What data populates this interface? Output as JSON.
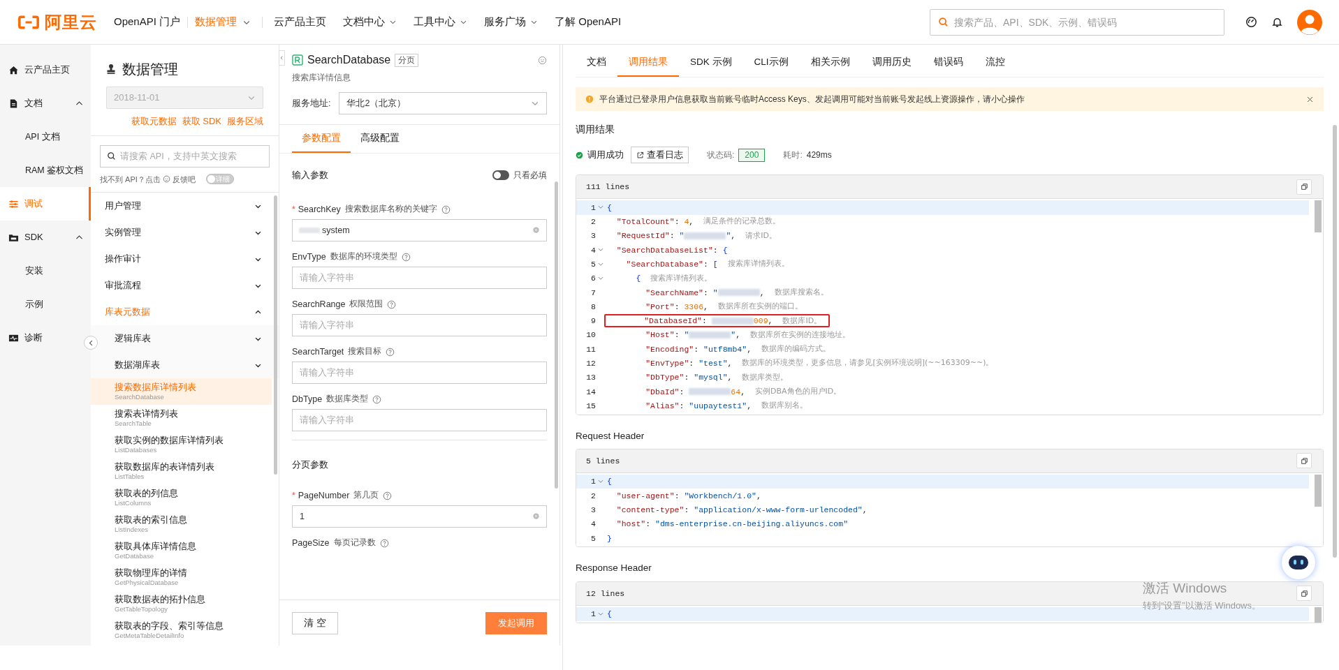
{
  "header": {
    "logo": "阿里云",
    "portal": "OpenAPI 门户",
    "product": {
      "label": "数据管理"
    },
    "nav": [
      {
        "label": "云产品主页",
        "dropdown": false
      },
      {
        "label": "文档中心",
        "dropdown": true
      },
      {
        "label": "工具中心",
        "dropdown": true
      },
      {
        "label": "服务广场",
        "dropdown": true
      },
      {
        "label": "了解 OpenAPI",
        "dropdown": false
      }
    ],
    "search": {
      "placeholder": "搜索产品、API、SDK、示例、错误码"
    }
  },
  "sidebar": {
    "items": [
      {
        "label": "云产品主页",
        "selected": false
      },
      {
        "label": "文档",
        "selected": false,
        "expanded": true,
        "children": [
          {
            "label": "API 文档",
            "selected": false
          },
          {
            "label": "RAM 鉴权文档",
            "selected": false
          }
        ]
      },
      {
        "label": "调试",
        "selected": true
      },
      {
        "label": "SDK",
        "selected": false,
        "expanded": true,
        "children": [
          {
            "label": "安装",
            "selected": false
          },
          {
            "label": "示例",
            "selected": false
          }
        ]
      },
      {
        "label": "诊断",
        "selected": false
      }
    ]
  },
  "api_panel": {
    "title": "数据管理",
    "version": {
      "value": "2018-11-01",
      "disabled": true
    },
    "links": [
      "获取元数据",
      "获取 SDK",
      "服务区域"
    ],
    "search": {
      "placeholder": "请搜索 API，支持中英文搜索"
    },
    "feedback": {
      "prefix": "找不到 API？点击",
      "link": "反馈吧"
    },
    "detail_toggle": {
      "label": "详细",
      "on": false
    },
    "tree": [
      {
        "kind": "group",
        "label": "用户管理",
        "expanded": false
      },
      {
        "kind": "group",
        "label": "实例管理",
        "expanded": false
      },
      {
        "kind": "group",
        "label": "操作审计",
        "expanded": false
      },
      {
        "kind": "group",
        "label": "审批流程",
        "expanded": false
      },
      {
        "kind": "group",
        "label": "库表元数据",
        "expanded": true,
        "children": [
          {
            "kind": "group",
            "label": "逻辑库表",
            "expanded": false
          },
          {
            "kind": "group",
            "label": "数据湖库表",
            "expanded": false
          },
          {
            "kind": "api",
            "label": "搜索数据库详情列表",
            "code": "SearchDatabase",
            "selected": true
          },
          {
            "kind": "api",
            "label": "搜索表详情列表",
            "code": "SearchTable",
            "selected": false
          },
          {
            "kind": "api",
            "label": "获取实例的数据库详情列表",
            "code": "ListDatabases",
            "selected": false
          },
          {
            "kind": "api",
            "label": "获取数据库的表详情列表",
            "code": "ListTables",
            "selected": false
          },
          {
            "kind": "api",
            "label": "获取表的列信息",
            "code": "ListColumns",
            "selected": false
          },
          {
            "kind": "api",
            "label": "获取表的索引信息",
            "code": "ListIndexes",
            "selected": false
          },
          {
            "kind": "api",
            "label": "获取具体库详情信息",
            "code": "GetDatabase",
            "selected": false
          },
          {
            "kind": "api",
            "label": "获取物理库的详情",
            "code": "GetPhysicalDatabase",
            "selected": false
          },
          {
            "kind": "api",
            "label": "获取数据表的拓扑信息",
            "code": "GetTableTopology",
            "selected": false
          },
          {
            "kind": "api",
            "label": "获取表的字段、索引等信息",
            "code": "GetMetaTableDetailInfo",
            "selected": false
          }
        ]
      }
    ]
  },
  "api_form": {
    "name": "SearchDatabase",
    "tag": "分页",
    "description": "搜索库详情信息",
    "endpoint": {
      "label": "服务地址:",
      "value": "华北2（北京）"
    },
    "tabs": [
      {
        "label": "参数配置",
        "selected": true
      },
      {
        "label": "高级配置",
        "selected": false
      }
    ],
    "required_only": {
      "label": "只看必填",
      "on": false
    },
    "sections": [
      {
        "title": "输入参数",
        "fields": [
          {
            "name": "SearchKey",
            "description": "搜索数据库名称的关键字",
            "required_mark": "*",
            "value": "system",
            "masked": true
          },
          {
            "name": "EnvType",
            "description": "数据库的环境类型",
            "placeholder": "请输入字符串"
          },
          {
            "name": "SearchRange",
            "description": "权限范围",
            "placeholder": "请输入字符串"
          },
          {
            "name": "SearchTarget",
            "description": "搜索目标",
            "placeholder": "请输入字符串"
          },
          {
            "name": "DbType",
            "description": "数据库类型",
            "placeholder": "请输入字符串"
          }
        ]
      },
      {
        "title": "分页参数",
        "fields": [
          {
            "name": "PageNumber",
            "description": "第几页",
            "required_mark": "*",
            "value": "1"
          },
          {
            "name": "PageSize",
            "description": "每页记录数"
          }
        ]
      }
    ],
    "buttons": {
      "clear": "清 空",
      "submit": "发起调用"
    }
  },
  "result_panel": {
    "tabs": [
      {
        "label": "文档",
        "selected": false
      },
      {
        "label": "调用结果",
        "selected": true
      },
      {
        "label": "SDK 示例",
        "selected": false
      },
      {
        "label": "CLI示例",
        "selected": false
      },
      {
        "label": "相关示例",
        "selected": false
      },
      {
        "label": "调用历史",
        "selected": false
      },
      {
        "label": "错误码",
        "selected": false
      },
      {
        "label": "流控",
        "selected": false
      }
    ],
    "notice": "平台通过已登录用户信息获取当前账号临时Access Keys、发起调用可能对当前账号发起线上资源操作，请小心操作",
    "title": "调用结果",
    "status": {
      "label": "调用成功",
      "log_button": "查看日志",
      "code_label": "状态码:",
      "code": "200",
      "time_label": "耗时:",
      "time": "429ms"
    },
    "blocks": [
      {
        "line_count": "111 lines",
        "lines": [
          {
            "no": "1",
            "fold": true,
            "current": true,
            "boxed": false,
            "tokens": [
              {
                "kind": "brace",
                "text": "{"
              }
            ]
          },
          {
            "no": "2",
            "fold": false,
            "current": false,
            "boxed": false,
            "tokens": [
              {
                "kind": "key",
                "text": "  \"TotalCount\""
              },
              {
                "kind": "punct",
                "text": ": "
              },
              {
                "kind": "num",
                "text": "4"
              },
              {
                "kind": "punct",
                "text": ","
              },
              {
                "kind": "comment",
                "text": "满足条件的记录总数。"
              }
            ]
          },
          {
            "no": "3",
            "fold": false,
            "current": false,
            "boxed": false,
            "tokens": [
              {
                "kind": "key",
                "text": "  \"RequestId\""
              },
              {
                "kind": "punct",
                "text": ": "
              },
              {
                "kind": "str",
                "text": "\""
              },
              {
                "kind": "redacted"
              },
              {
                "kind": "str",
                "text": "\""
              },
              {
                "kind": "punct",
                "text": ","
              },
              {
                "kind": "comment",
                "text": "请求ID。"
              }
            ]
          },
          {
            "no": "4",
            "fold": true,
            "current": false,
            "boxed": false,
            "tokens": [
              {
                "kind": "key",
                "text": "  \"SearchDatabaseList\""
              },
              {
                "kind": "punct",
                "text": ": "
              },
              {
                "kind": "brace",
                "text": "{"
              }
            ]
          },
          {
            "no": "5",
            "fold": true,
            "current": false,
            "boxed": false,
            "tokens": [
              {
                "kind": "key",
                "text": "    \"SearchDatabase\""
              },
              {
                "kind": "punct",
                "text": ": "
              },
              {
                "kind": "brace",
                "text": "["
              },
              {
                "kind": "comment",
                "text": "搜索库详情列表。"
              }
            ]
          },
          {
            "no": "6",
            "fold": true,
            "current": false,
            "boxed": false,
            "tokens": [
              {
                "kind": "brace",
                "text": "      {"
              },
              {
                "kind": "comment",
                "text": "搜索库详情列表。"
              }
            ]
          },
          {
            "no": "7",
            "fold": false,
            "current": false,
            "boxed": false,
            "tokens": [
              {
                "kind": "key",
                "text": "        \"SearchName\""
              },
              {
                "kind": "punct",
                "text": ": "
              },
              {
                "kind": "str",
                "text": "\""
              },
              {
                "kind": "redacted"
              },
              {
                "kind": "punct",
                "text": ","
              },
              {
                "kind": "comment",
                "text": "数据库搜索名。"
              }
            ]
          },
          {
            "no": "8",
            "fold": false,
            "current": false,
            "boxed": false,
            "tokens": [
              {
                "kind": "key",
                "text": "        \"Port\""
              },
              {
                "kind": "punct",
                "text": ": "
              },
              {
                "kind": "num",
                "text": "3306"
              },
              {
                "kind": "punct",
                "text": ","
              },
              {
                "kind": "comment",
                "text": "数据库所在实例的端口。"
              }
            ]
          },
          {
            "no": "9",
            "fold": false,
            "current": false,
            "boxed": true,
            "tokens": [
              {
                "kind": "key",
                "text": "        \"DatabaseId\""
              },
              {
                "kind": "punct",
                "text": ": "
              },
              {
                "kind": "redacted"
              },
              {
                "kind": "num",
                "text": "009"
              },
              {
                "kind": "punct",
                "text": ","
              },
              {
                "kind": "comment",
                "text": "数据库ID。"
              }
            ]
          },
          {
            "no": "10",
            "fold": false,
            "current": false,
            "boxed": false,
            "tokens": [
              {
                "kind": "key",
                "text": "        \"Host\""
              },
              {
                "kind": "punct",
                "text": ": "
              },
              {
                "kind": "str",
                "text": "\""
              },
              {
                "kind": "redacted"
              },
              {
                "kind": "str",
                "text": "\""
              },
              {
                "kind": "punct",
                "text": ","
              },
              {
                "kind": "comment",
                "text": "数据库所在实例的连接地址。"
              }
            ]
          },
          {
            "no": "11",
            "fold": false,
            "current": false,
            "boxed": false,
            "tokens": [
              {
                "kind": "key",
                "text": "        \"Encoding\""
              },
              {
                "kind": "punct",
                "text": ": "
              },
              {
                "kind": "str",
                "text": "\"utf8mb4\""
              },
              {
                "kind": "punct",
                "text": ","
              },
              {
                "kind": "comment",
                "text": "数据库的编码方式。"
              }
            ]
          },
          {
            "no": "12",
            "fold": false,
            "current": false,
            "boxed": false,
            "tokens": [
              {
                "kind": "key",
                "text": "        \"EnvType\""
              },
              {
                "kind": "punct",
                "text": ": "
              },
              {
                "kind": "str",
                "text": "\"test\""
              },
              {
                "kind": "punct",
                "text": ","
              },
              {
                "kind": "comment",
                "text": "数据库的环境类型，更多信息，请参见[实例环境说明](~~163309~~)。"
              }
            ]
          },
          {
            "no": "13",
            "fold": false,
            "current": false,
            "boxed": false,
            "tokens": [
              {
                "kind": "key",
                "text": "        \"DbType\""
              },
              {
                "kind": "punct",
                "text": ": "
              },
              {
                "kind": "str",
                "text": "\"mysql\""
              },
              {
                "kind": "punct",
                "text": ","
              },
              {
                "kind": "comment",
                "text": "数据库类型。"
              }
            ]
          },
          {
            "no": "14",
            "fold": false,
            "current": false,
            "boxed": false,
            "tokens": [
              {
                "kind": "key",
                "text": "        \"DbaId\""
              },
              {
                "kind": "punct",
                "text": ": "
              },
              {
                "kind": "redacted"
              },
              {
                "kind": "num",
                "text": "64"
              },
              {
                "kind": "punct",
                "text": ","
              },
              {
                "kind": "comment",
                "text": "实例DBA角色的用户ID。"
              }
            ]
          },
          {
            "no": "15",
            "fold": false,
            "current": false,
            "boxed": false,
            "tokens": [
              {
                "kind": "key",
                "text": "        \"Alias\""
              },
              {
                "kind": "punct",
                "text": ": "
              },
              {
                "kind": "str",
                "text": "\"uupaytest1\""
              },
              {
                "kind": "punct",
                "text": ","
              },
              {
                "kind": "comment",
                "text": "数据库别名。"
              }
            ]
          }
        ]
      },
      {
        "title": "Request Header",
        "line_count": "5 lines",
        "lines": [
          {
            "no": "1",
            "fold": true,
            "current": true,
            "boxed": false,
            "tokens": [
              {
                "kind": "brace",
                "text": "{"
              }
            ]
          },
          {
            "no": "2",
            "fold": false,
            "current": false,
            "boxed": false,
            "tokens": [
              {
                "kind": "key",
                "text": "  \"user-agent\""
              },
              {
                "kind": "punct",
                "text": ": "
              },
              {
                "kind": "str",
                "text": "\"Workbench/1.0\""
              },
              {
                "kind": "punct",
                "text": ","
              }
            ]
          },
          {
            "no": "3",
            "fold": false,
            "current": false,
            "boxed": false,
            "tokens": [
              {
                "kind": "key",
                "text": "  \"content-type\""
              },
              {
                "kind": "punct",
                "text": ": "
              },
              {
                "kind": "str",
                "text": "\"application/x-www-form-urlencoded\""
              },
              {
                "kind": "punct",
                "text": ","
              }
            ]
          },
          {
            "no": "4",
            "fold": false,
            "current": false,
            "boxed": false,
            "tokens": [
              {
                "kind": "key",
                "text": "  \"host\""
              },
              {
                "kind": "punct",
                "text": ": "
              },
              {
                "kind": "str",
                "text": "\"dms-enterprise.cn-beijing.aliyuncs.com\""
              }
            ]
          },
          {
            "no": "5",
            "fold": false,
            "current": false,
            "boxed": false,
            "tokens": [
              {
                "kind": "brace",
                "text": "}"
              }
            ]
          }
        ]
      },
      {
        "title": "Response Header",
        "line_count": "12 lines",
        "lines": [
          {
            "no": "1",
            "fold": true,
            "current": true,
            "boxed": false,
            "tokens": [
              {
                "kind": "brace",
                "text": "{"
              }
            ]
          }
        ]
      }
    ]
  },
  "os_notice": {
    "title": "激活 Windows",
    "text": "转到“设置”以激活 Windows。"
  }
}
